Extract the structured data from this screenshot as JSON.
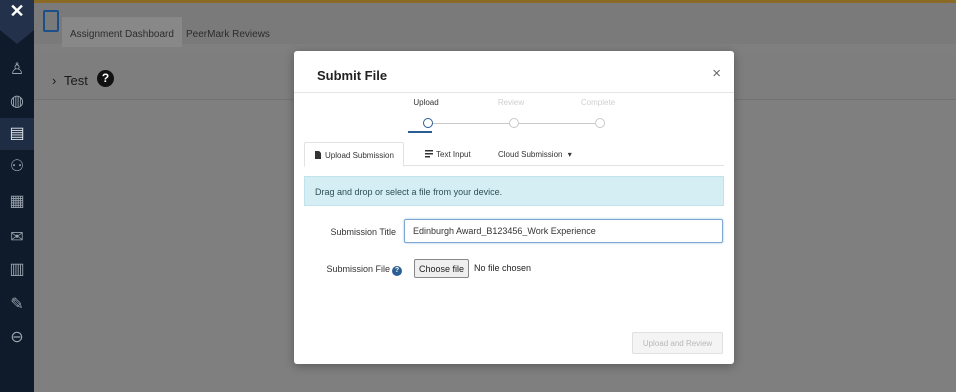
{
  "sidebar": {
    "close_glyph": "✕",
    "items": [
      {
        "icon": "user-icon",
        "glyph": "♙"
      },
      {
        "icon": "globe-icon",
        "glyph": "◍"
      },
      {
        "icon": "assignment-icon",
        "glyph": "▤"
      },
      {
        "icon": "people-icon",
        "glyph": "⚇"
      },
      {
        "icon": "calendar-icon",
        "glyph": "▦"
      },
      {
        "icon": "mail-icon",
        "glyph": "✉"
      },
      {
        "icon": "document-icon",
        "glyph": "▥"
      },
      {
        "icon": "edit-icon",
        "glyph": "✎"
      },
      {
        "icon": "logout-icon",
        "glyph": "⊖"
      }
    ]
  },
  "topbar": {
    "tabs": [
      "Assignment Dashboard",
      "PeerMark Reviews"
    ]
  },
  "page": {
    "crumb_chevron": "›",
    "crumb_label": "Test",
    "help_glyph": "?"
  },
  "modal": {
    "title": "Submit File",
    "close_glyph": "×",
    "steps": [
      "Upload",
      "Review",
      "Complete"
    ],
    "tabs": [
      "Upload Submission",
      "Text Input",
      "Cloud Submission"
    ],
    "cloud_caret": "▾",
    "info_text": "Drag and drop or select a file from your device.",
    "title_label": "Submission Title",
    "title_value": "Edinburgh Award_B123456_Work Experience",
    "file_label": "Submission File",
    "file_help_glyph": "?",
    "choose_file_label": "Choose file",
    "no_file_text": "No file chosen",
    "upload_button": "Upload and Review"
  },
  "colors": {
    "sidebar": "#0f1b2b",
    "accent": "#2b5f93",
    "info_bg": "#d4eef4"
  }
}
